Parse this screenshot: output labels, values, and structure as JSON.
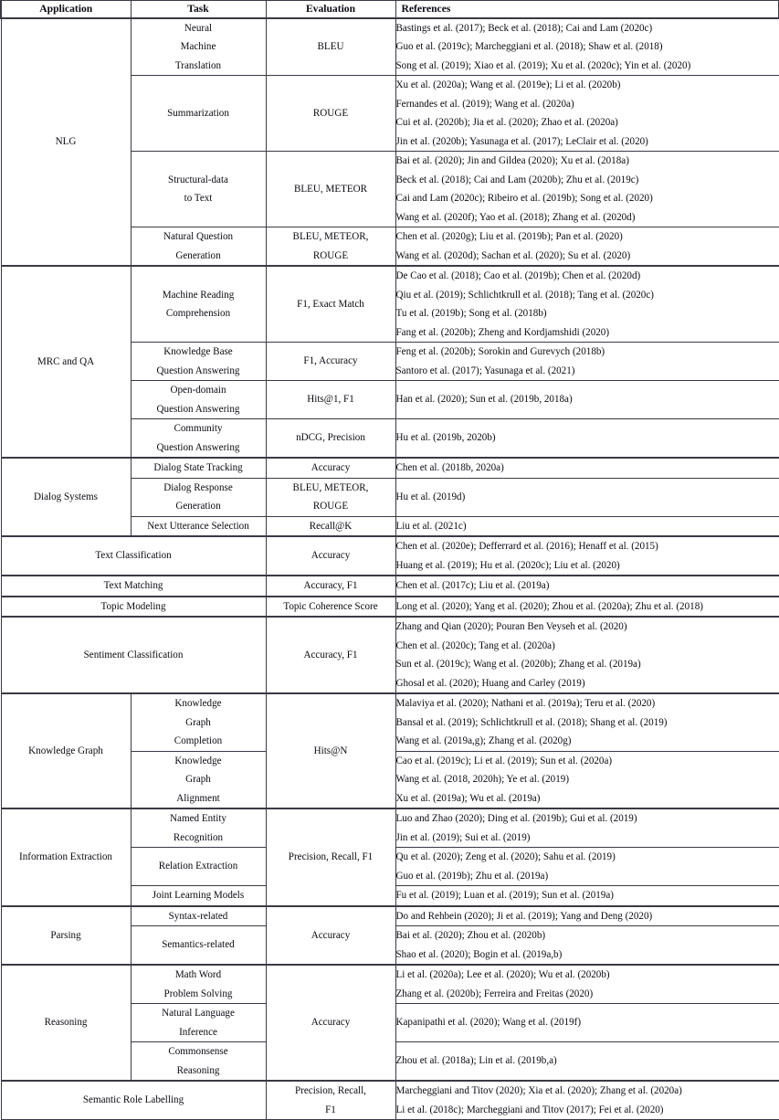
{
  "table": {
    "headers": {
      "application": "Application",
      "task": "Task",
      "evaluation": "Evaluation",
      "references": "References"
    },
    "groups": [
      {
        "application": "NLG",
        "rows": [
          {
            "task": [
              "Neural",
              "Machine",
              "Translation"
            ],
            "evaluation": [
              "BLEU"
            ],
            "references": [
              "Bastings et al. (2017); Beck et al. (2018); Cai and Lam (2020c)",
              "Guo et al. (2019c); Marcheggiani et al. (2018); Shaw et al. (2018)",
              "Song et al. (2019); Xiao et al. (2019); Xu et al. (2020c); Yin et al. (2020)"
            ]
          },
          {
            "task": [
              "Summarization"
            ],
            "evaluation": [
              "ROUGE"
            ],
            "references": [
              "Xu et al. (2020a); Wang et al. (2019e); Li et al. (2020b)",
              "Fernandes et al. (2019); Wang et al. (2020a)",
              "Cui et al. (2020b); Jia et al. (2020); Zhao et al. (2020a)",
              "Jin et al. (2020b); Yasunaga et al. (2017); LeClair et al. (2020)"
            ]
          },
          {
            "task": [
              "Structural-data",
              "to Text"
            ],
            "evaluation": [
              "BLEU, METEOR"
            ],
            "references": [
              "Bai et al. (2020); Jin and Gildea (2020); Xu et al. (2018a)",
              "Beck et al. (2018); Cai and Lam (2020b); Zhu et al. (2019c)",
              "Cai and Lam (2020c); Ribeiro et al. (2019b); Song et al. (2020)",
              "Wang et al. (2020f); Yao et al. (2018); Zhang et al. (2020d)"
            ]
          },
          {
            "task": [
              "Natural Question",
              "Generation"
            ],
            "evaluation": [
              "BLEU, METEOR,",
              "ROUGE"
            ],
            "references": [
              "Chen et al. (2020g); Liu et al. (2019b); Pan et al. (2020)",
              "Wang et al. (2020d); Sachan et al. (2020); Su et al. (2020)"
            ]
          }
        ]
      },
      {
        "application": "MRC and QA",
        "rows": [
          {
            "task": [
              "Machine Reading",
              "Comprehension"
            ],
            "evaluation": [
              "F1, Exact Match"
            ],
            "references": [
              "De Cao et al. (2018); Cao et al. (2019b); Chen et al. (2020d)",
              "Qiu et al. (2019); Schlichtkrull et al. (2018); Tang et al. (2020c)",
              "Tu et al. (2019b); Song et al. (2018b)",
              "Fang et al. (2020b); Zheng and Kordjamshidi (2020)"
            ]
          },
          {
            "task": [
              "Knowledge Base",
              "Question Answering"
            ],
            "evaluation": [
              "F1, Accuracy"
            ],
            "references": [
              "Feng et al. (2020b); Sorokin and Gurevych (2018b)",
              "Santoro et al. (2017); Yasunaga et al. (2021)"
            ]
          },
          {
            "task": [
              "Open-domain",
              "Question Answering"
            ],
            "evaluation": [
              "Hits@1, F1"
            ],
            "references": [
              "Han et al. (2020); Sun et al. (2019b, 2018a)"
            ]
          },
          {
            "task": [
              "Community",
              "Question Answering"
            ],
            "evaluation": [
              "nDCG, Precision"
            ],
            "references": [
              "Hu et al. (2019b, 2020b)"
            ]
          }
        ]
      },
      {
        "application": "Dialog Systems",
        "rows": [
          {
            "task": [
              "Dialog State Tracking"
            ],
            "evaluation": [
              "Accuracy"
            ],
            "references": [
              "Chen et al. (2018b, 2020a)"
            ]
          },
          {
            "task": [
              "Dialog Response",
              "Generation"
            ],
            "evaluation": [
              "BLEU, METEOR,",
              "ROUGE"
            ],
            "references": [
              "Hu et al. (2019d)"
            ]
          },
          {
            "task": [
              "Next Utterance Selection"
            ],
            "evaluation": [
              "Recall@K"
            ],
            "references": [
              "Liu et al. (2021c)"
            ]
          }
        ]
      },
      {
        "application": "Text Classification",
        "span_app_task": true,
        "rows": [
          {
            "task": [],
            "evaluation": [
              "Accuracy"
            ],
            "references": [
              "Chen et al. (2020e); Defferrard et al. (2016); Henaff et al. (2015)",
              "Huang et al. (2019); Hu et al. (2020c); Liu et al. (2020)"
            ]
          }
        ]
      },
      {
        "application": "Text Matching",
        "span_app_task": true,
        "rows": [
          {
            "task": [],
            "evaluation": [
              "Accuracy, F1"
            ],
            "references": [
              "Chen et al. (2017c); Liu et al. (2019a)"
            ]
          }
        ]
      },
      {
        "application": "Topic Modeling",
        "span_app_task": true,
        "rows": [
          {
            "task": [],
            "evaluation": [
              "Topic Coherence Score"
            ],
            "references": [
              "Long et al. (2020); Yang et al. (2020); Zhou et al. (2020a); Zhu et al. (2018)"
            ]
          }
        ]
      },
      {
        "application": "Sentiment Classification",
        "span_app_task": true,
        "rows": [
          {
            "task": [],
            "evaluation": [
              "Accuracy, F1"
            ],
            "references": [
              "Zhang and Qian (2020); Pouran Ben Veyseh et al. (2020)",
              "Chen et al. (2020c); Tang et al. (2020a)",
              "Sun et al. (2019c); Wang et al. (2020b); Zhang et al. (2019a)",
              "Ghosal et al. (2020); Huang and Carley (2019)"
            ]
          }
        ]
      },
      {
        "application": "Knowledge Graph",
        "shared_evaluation": [
          "Hits@N"
        ],
        "rows": [
          {
            "task": [
              "Knowledge",
              "Graph",
              "Completion"
            ],
            "references": [
              "Malaviya et al. (2020); Nathani et al. (2019a); Teru et al. (2020)",
              "Bansal et al. (2019); Schlichtkrull et al. (2018); Shang et al. (2019)",
              "Wang et al. (2019a,g); Zhang et al. (2020g)"
            ]
          },
          {
            "task": [
              "Knowledge",
              "Graph",
              "Alignment"
            ],
            "references": [
              "Cao et al. (2019c); Li et al. (2019); Sun et al. (2020a)",
              "Wang et al. (2018, 2020h); Ye et al. (2019)",
              "Xu et al. (2019a); Wu et al. (2019a)"
            ]
          }
        ]
      },
      {
        "application": "Information Extraction",
        "shared_evaluation": [
          "Precision, Recall, F1"
        ],
        "rows": [
          {
            "task": [
              "Named Entity",
              "Recognition"
            ],
            "references": [
              "Luo and Zhao (2020); Ding et al. (2019b); Gui et al. (2019)",
              "Jin et al. (2019); Sui et al. (2019)"
            ]
          },
          {
            "task": [
              "Relation Extraction"
            ],
            "references": [
              "Qu et al. (2020); Zeng et al. (2020); Sahu et al. (2019)",
              "Guo et al. (2019b); Zhu et al. (2019a)"
            ]
          },
          {
            "task": [
              "Joint Learning Models"
            ],
            "references": [
              "Fu et al. (2019); Luan et al. (2019); Sun et al. (2019a)"
            ]
          }
        ]
      },
      {
        "application": "Parsing",
        "shared_evaluation": [
          "Accuracy"
        ],
        "rows": [
          {
            "task": [
              "Syntax-related"
            ],
            "references": [
              "Do and Rehbein (2020); Ji et al. (2019); Yang and Deng (2020)"
            ]
          },
          {
            "task": [
              "Semantics-related"
            ],
            "references": [
              "Bai et al. (2020); Zhou et al. (2020b)",
              "Shao et al. (2020); Bogin et al. (2019a,b)"
            ]
          }
        ]
      },
      {
        "application": "Reasoning",
        "shared_evaluation": [
          "Accuracy"
        ],
        "rows": [
          {
            "task": [
              "Math Word",
              "Problem Solving"
            ],
            "references": [
              "Li et al. (2020a); Lee et al. (2020); Wu et al. (2020b)",
              "Zhang et al. (2020b); Ferreira and Freitas (2020)"
            ]
          },
          {
            "task": [
              "Natural Language",
              "Inference"
            ],
            "references": [
              "Kapanipathi et al. (2020); Wang et al. (2019f)"
            ]
          },
          {
            "task": [
              "Commonsense",
              "Reasoning"
            ],
            "references": [
              "Zhou et al. (2018a); Lin et al. (2019b,a)"
            ]
          }
        ]
      },
      {
        "application": "Semantic Role Labelling",
        "span_app_task": true,
        "rows": [
          {
            "task": [],
            "evaluation": [
              "Precision, Recall,",
              "F1"
            ],
            "references": [
              "Marcheggiani and Titov (2020); Xia et al. (2020); Zhang et al. (2020a)",
              "Li et al. (2018c); Marcheggiani and Titov (2017); Fei et al. (2020)"
            ]
          }
        ]
      }
    ]
  }
}
